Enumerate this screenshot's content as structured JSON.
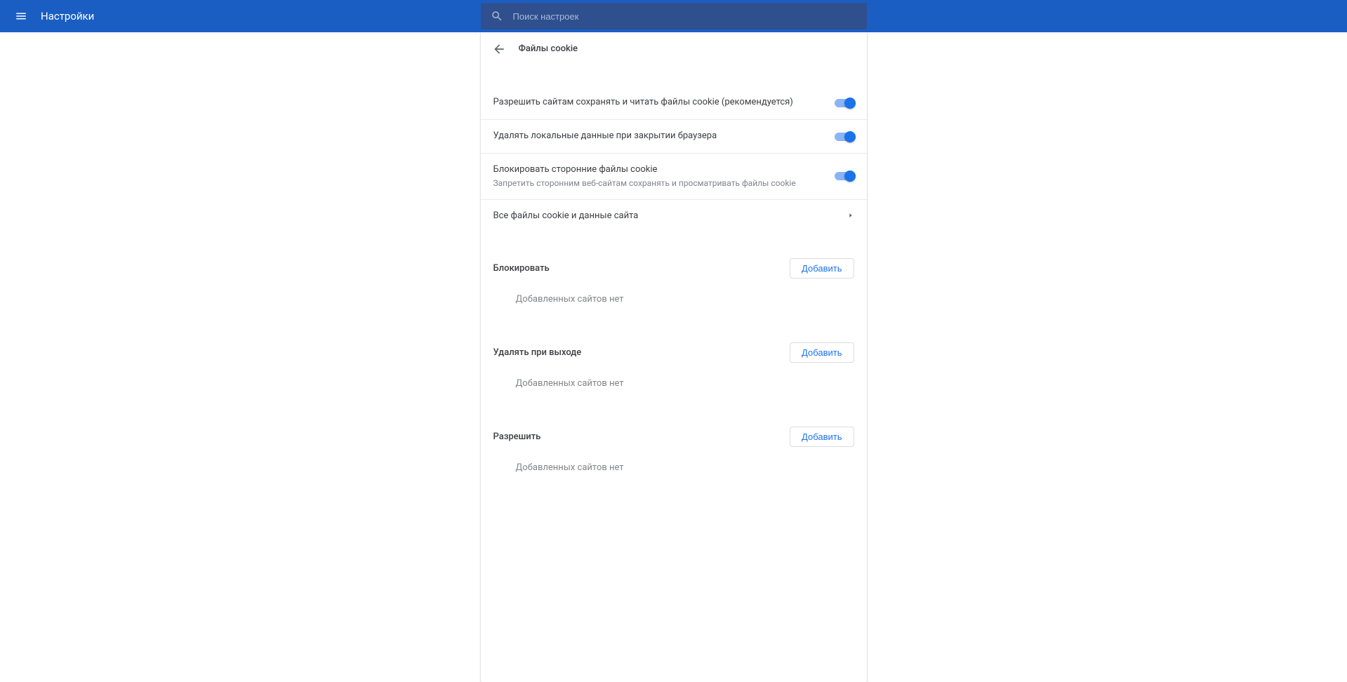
{
  "topbar": {
    "title": "Настройки",
    "search_placeholder": "Поиск настроек"
  },
  "header": {
    "title": "Файлы cookie"
  },
  "toggles": {
    "allow_cookies": {
      "label": "Разрешить сайтам сохранять и читать файлы cookie (рекомендуется)",
      "on": true
    },
    "delete_on_close": {
      "label": "Удалять локальные данные при закрытии браузера",
      "on": true
    },
    "block_third_party": {
      "label": "Блокировать сторонние файлы cookie",
      "sub": "Запретить сторонним веб-сайтам сохранять и просматривать файлы cookie",
      "on": true
    }
  },
  "link": {
    "all_cookies": "Все файлы cookie и данные сайта"
  },
  "sections": {
    "block": {
      "title": "Блокировать",
      "add": "Добавить",
      "empty": "Добавленных сайтов нет"
    },
    "clear": {
      "title": "Удалять при выходе",
      "add": "Добавить",
      "empty": "Добавленных сайтов нет"
    },
    "allow": {
      "title": "Разрешить",
      "add": "Добавить",
      "empty": "Добавленных сайтов нет"
    }
  }
}
